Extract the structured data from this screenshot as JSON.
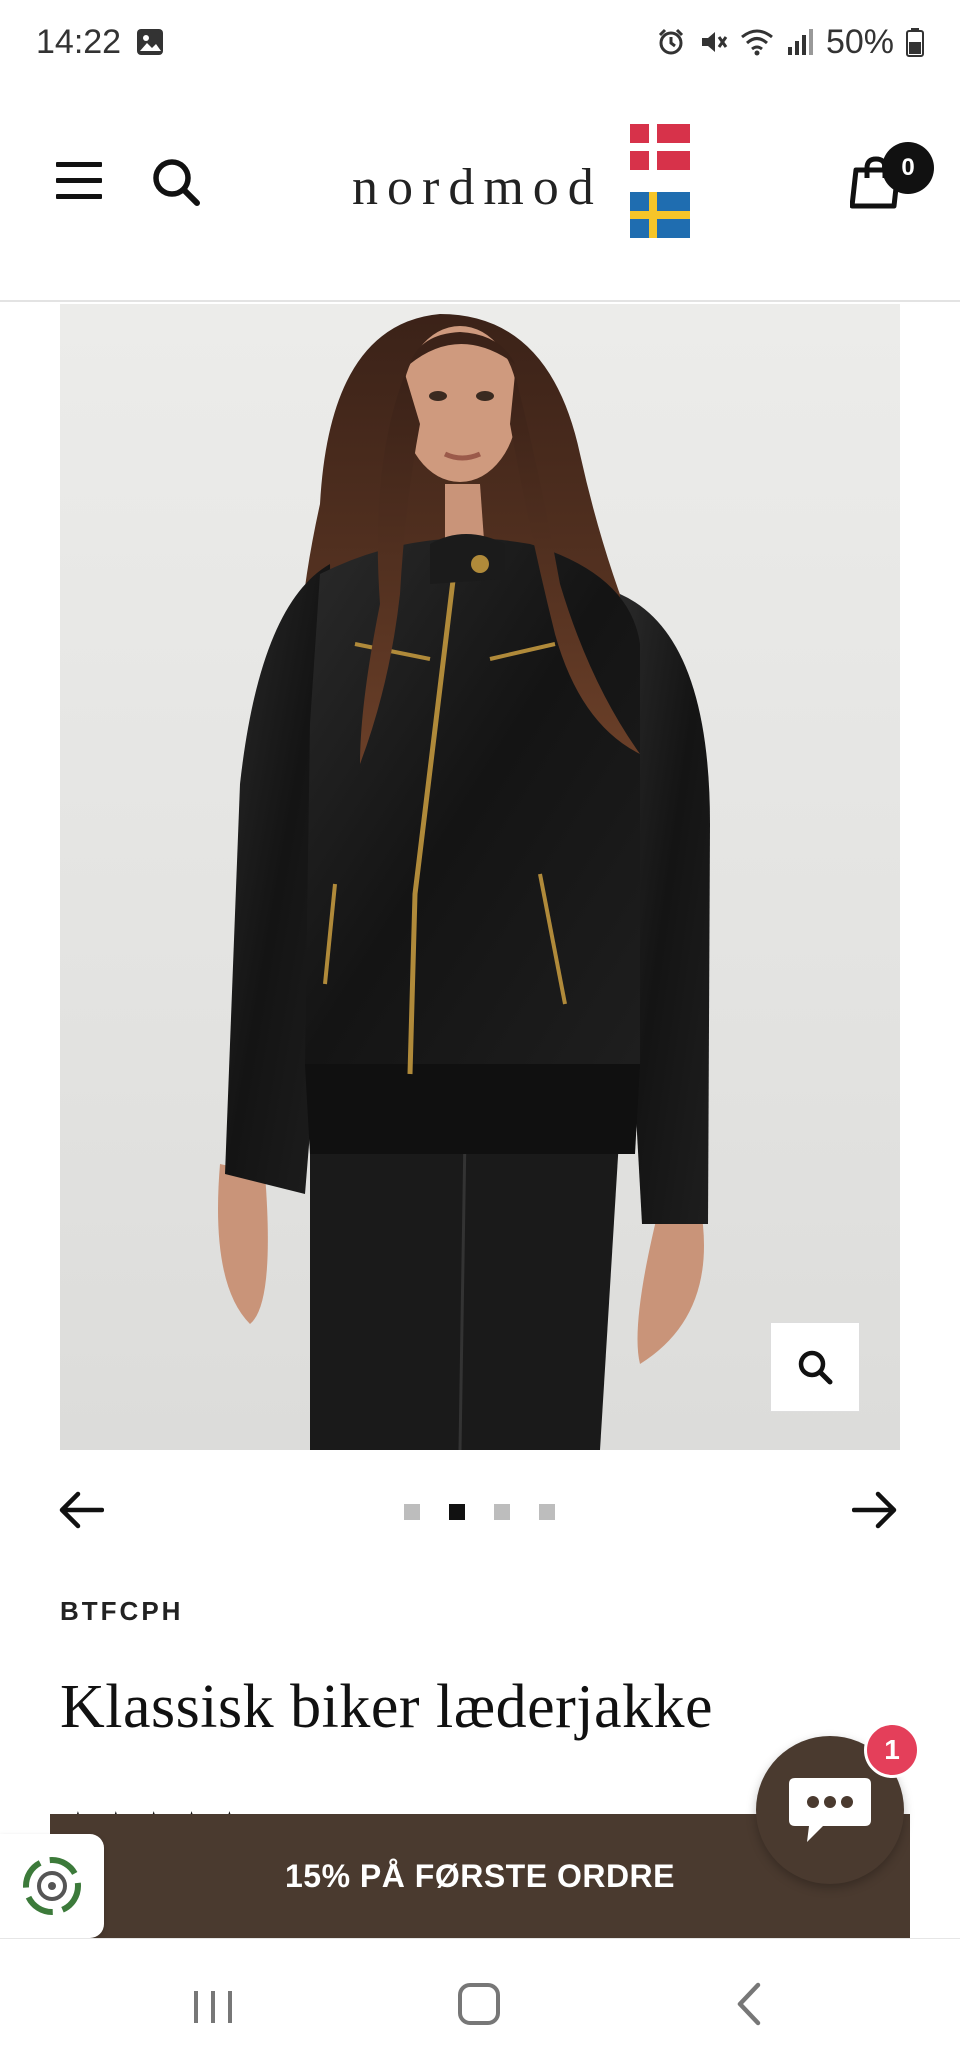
{
  "status_bar": {
    "time": "14:22",
    "battery": "50%",
    "icons": [
      "gallery-icon",
      "alarm-icon",
      "mute-icon",
      "wifi-icon",
      "signal-icon",
      "battery-icon"
    ]
  },
  "header": {
    "logo": "nordmod",
    "cart_count": "0",
    "flags": [
      "denmark-flag",
      "sweden-flag"
    ]
  },
  "gallery": {
    "slide_count": 4,
    "active_slide": 2
  },
  "product": {
    "brand": "BTFCPH",
    "title": "Klassisk biker læderjakke",
    "rating_stars": "★★★★★"
  },
  "chat": {
    "badge_count": "1"
  },
  "promo": {
    "text": "15% PÅ FØRSTE ORDRE"
  },
  "colors": {
    "brand_brown": "#4a3a2f",
    "badge_red": "#e43f5a",
    "text": "#111111"
  }
}
